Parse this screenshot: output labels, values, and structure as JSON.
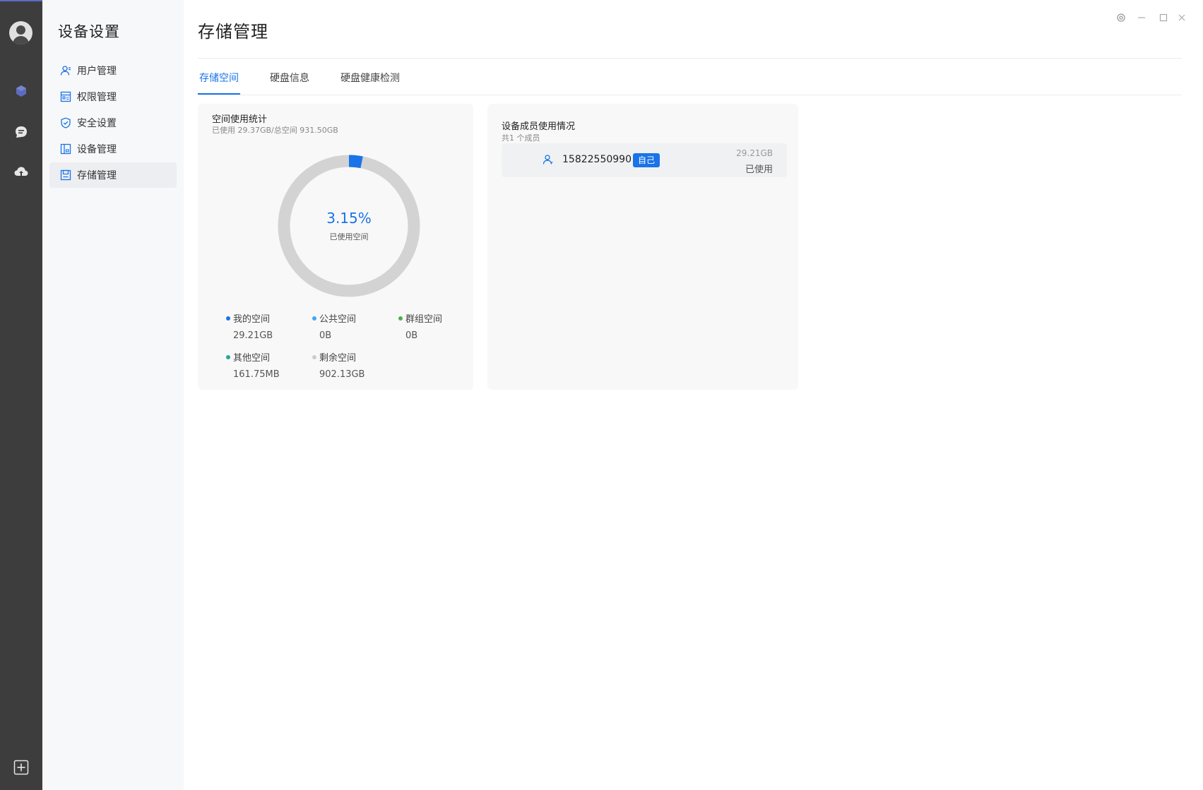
{
  "colors": {
    "accent": "#1a73e8",
    "rail_bg": "#3d3d3d",
    "sidebar_bg": "#f7f8f9",
    "legend_my": "#1a73e8",
    "legend_public": "#42a5f5",
    "legend_group": "#4caf50",
    "legend_other": "#26a69a",
    "legend_free": "#cccccc"
  },
  "rail": {
    "icons": [
      "avatar-icon",
      "cube-icon",
      "chat-icon",
      "cloud-upload-icon",
      "add-panel-icon"
    ]
  },
  "sidebar": {
    "title": "设备设置",
    "items": [
      {
        "label": "用户管理",
        "icon": "user-icon"
      },
      {
        "label": "权限管理",
        "icon": "permission-icon"
      },
      {
        "label": "安全设置",
        "icon": "shield-icon"
      },
      {
        "label": "设备管理",
        "icon": "device-icon"
      },
      {
        "label": "存储管理",
        "icon": "storage-icon",
        "active": true
      }
    ]
  },
  "main": {
    "title": "存储管理",
    "tabs": [
      {
        "label": "存储空间",
        "active": true
      },
      {
        "label": "硬盘信息"
      },
      {
        "label": "硬盘健康检测"
      }
    ]
  },
  "space_card": {
    "title": "空间使用统计",
    "subtitle": "已使用 29.37GB/总空间 931.50GB",
    "percent_text": "3.15%",
    "percent_value": 3.15,
    "center_label": "已使用空间",
    "legend": [
      {
        "name": "我的空间",
        "value": "29.21GB",
        "color": "#1a73e8"
      },
      {
        "name": "公共空间",
        "value": "0B",
        "color": "#42a5f5"
      },
      {
        "name": "群组空间",
        "value": "0B",
        "color": "#4caf50"
      },
      {
        "name": "其他空间",
        "value": "161.75MB",
        "color": "#26a69a"
      },
      {
        "name": "剩余空间",
        "value": "902.13GB",
        "color": "#cccccc"
      }
    ]
  },
  "member_card": {
    "title": "设备成员使用情况",
    "subtitle": "共1 个成员",
    "members": [
      {
        "phone": "15822550990",
        "badge": "自己",
        "size": "29.21GB",
        "used_label": "已使用"
      }
    ]
  }
}
